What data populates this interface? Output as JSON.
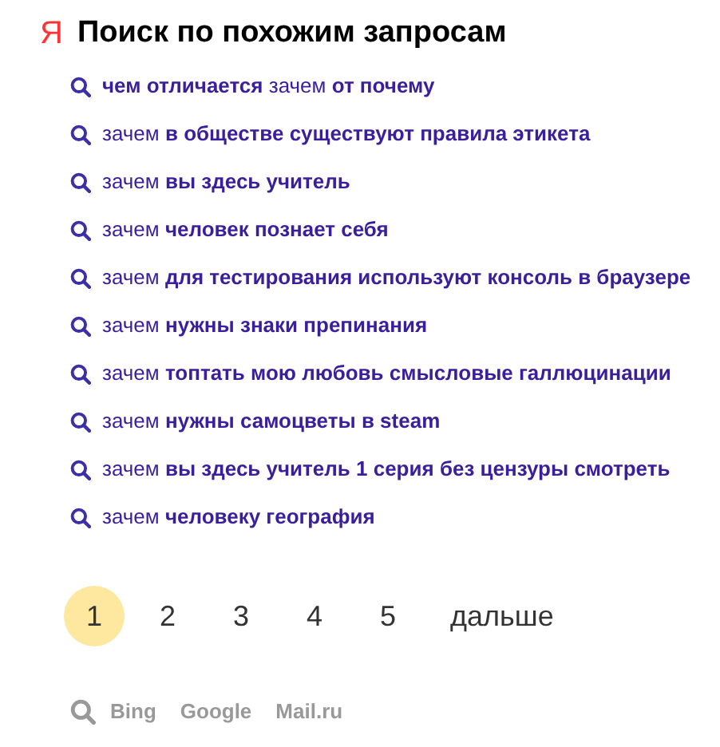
{
  "logo": "Я",
  "title": "Поиск по похожим запросам",
  "suggestions": [
    "**чем отличается** зачем **от почему**",
    "зачем **в обществе существуют правила этикета**",
    "зачем **вы здесь учитель**",
    "зачем **человек познает себя**",
    "зачем **для тестирования используют консоль в браузере**",
    "зачем **нужны знаки препинания**",
    "зачем **топтать мою любовь смысловые галлюцинации**",
    "зачем **нужны самоцветы в steam**",
    "зачем **вы здесь учитель 1 серия без цензуры смотреть**",
    "зачем **человеку география**"
  ],
  "pagination": [
    {
      "label": "1",
      "selected": true
    },
    {
      "label": "2",
      "selected": false
    },
    {
      "label": "3",
      "selected": false
    },
    {
      "label": "4",
      "selected": false
    },
    {
      "label": "5",
      "selected": false
    }
  ],
  "next": "дальше",
  "other_engines": [
    "Bing",
    "Google",
    "Mail.ru"
  ]
}
